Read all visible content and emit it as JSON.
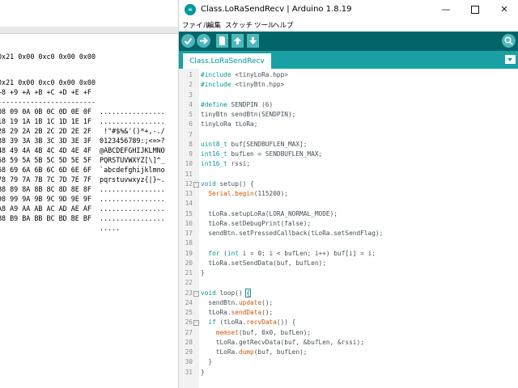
{
  "left_pane": {
    "hex_lines": [
      "0x21 0x00 0xc0 0x00 0x00",
      "",
      "0x21 0x00 0xc0 0x00 0x00",
      "+8 +9 +A +B +C +D +E +F",
      "------------------------",
      "08 09 0A 0B 0C 0D 0E 0F  ................",
      "18 19 1A 1B 1C 1D 1E 1F  ................",
      "28 29 2A 2B 2C 2D 2E 2F   !\"#$%&'()*+,-./",
      "38 39 3A 3B 3C 3D 3E 3F  0123456789:;<=>?",
      "48 49 4A 4B 4C 4D 4E 4F  @ABCDEFGHIJKLMNO",
      "58 59 5A 5B 5C 5D 5E 5F  PQRSTUVWXYZ[\\]^_",
      "68 69 6A 6B 6C 6D 6E 6F  `abcdefghijklmno",
      "78 79 7A 7B 7C 7D 7E 7F  pqrstuvwxyz{|}~.",
      "88 89 8A 8B 8C 8D 8E 8F  ................",
      "98 99 9A 9B 9C 9D 9E 9F  ................",
      "A8 A9 AA AB AC AD AE AF  ................",
      "B8 B9 BA BB BC BD BE BF  ................",
      "                         ....."
    ]
  },
  "window": {
    "logo_text": "∞",
    "title": "Class.LoRaSendRecv | Arduino 1.8.19",
    "minimize": "—",
    "close": "✕"
  },
  "menu": [
    "ファイル",
    "編集",
    "スケッチ",
    "ツール",
    "ヘルプ"
  ],
  "toolbar": {
    "icons": [
      "verify-icon",
      "upload-icon",
      "new-icon",
      "open-icon",
      "save-icon",
      "serial-monitor-icon"
    ]
  },
  "tabs": {
    "active": "Class.LoRaSendRecv"
  },
  "colors": {
    "toolbar_bg": "#006468",
    "tab_bar_bg": "#17a1a5",
    "button_bg": "#4db7bb",
    "keyword": "#00979c",
    "function": "#d35400"
  },
  "editor": {
    "line_numbers": [
      "1",
      "2",
      "3",
      "4",
      "5",
      "6",
      "7",
      "8",
      "9",
      "10",
      "11",
      "12",
      "13",
      "14",
      "15",
      "16",
      "17",
      "18",
      "19",
      "20",
      "21",
      "22",
      "23",
      "24",
      "25",
      "26",
      "27",
      "28",
      "29",
      "30",
      "31"
    ],
    "code_lines": [
      "#include <tinyLoRa.hpp>",
      "#include <tinyBtn.hpp>",
      "",
      "#define SENDPIN (6)",
      "tinyBtn sendBtn(SENDPIN);",
      "tinyLoRa tLoRa;",
      "",
      "uint8_t buf[SENDBUFLEN_MAX];",
      "int16_t bufLen = SENDBUFLEN_MAX;",
      "int16_t rssi;",
      "",
      "void setup() {",
      "  Serial.begin(115200);",
      "",
      "  tLoRa.setupLoRa(LORA_NORMAL_MODE);",
      "  tLoRa.setDebugPrint(false);",
      "  sendBtn.setPressedCallback(tLoRa.setSendFlag);",
      "",
      "  for (int i = 0; i < bufLen; i++) buf[i] = i;",
      "  tLoRa.setSendData(buf, bufLen);",
      "}",
      "",
      "void loop() {",
      "  sendBtn.update();",
      "  tLoRa.sendData();",
      "  if (tLoRa.recvData()) {",
      "    memset(buf, 0x0, bufLen);",
      "    tLoRa.getRecvData(buf, &bufLen, &rssi);",
      "    tLoRa.dump(buf, bufLen);",
      "  }",
      "}"
    ],
    "fold_marks": {
      "12": "−",
      "23": "−",
      "26": "−"
    }
  }
}
